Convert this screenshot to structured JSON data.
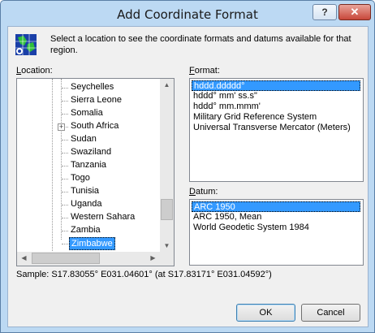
{
  "window": {
    "title": "Add Coordinate Format",
    "help_glyph": "?",
    "close_glyph": "✕"
  },
  "intro_text": "Select a location to see the coordinate formats and datums available for that region.",
  "location": {
    "label_prefix": "",
    "label_accel": "L",
    "label_rest": "ocation:",
    "items": [
      {
        "label": "Seychelles",
        "expandable": false
      },
      {
        "label": "Sierra Leone",
        "expandable": false
      },
      {
        "label": "Somalia",
        "expandable": false
      },
      {
        "label": "South Africa",
        "expandable": true
      },
      {
        "label": "Sudan",
        "expandable": false
      },
      {
        "label": "Swaziland",
        "expandable": false
      },
      {
        "label": "Tanzania",
        "expandable": false
      },
      {
        "label": "Togo",
        "expandable": false
      },
      {
        "label": "Tunisia",
        "expandable": false
      },
      {
        "label": "Uganda",
        "expandable": false
      },
      {
        "label": "Western Sahara",
        "expandable": false
      },
      {
        "label": "Zambia",
        "expandable": false
      },
      {
        "label": "Zimbabwe",
        "expandable": false,
        "selected": true
      }
    ],
    "scroll_position": 0.85
  },
  "format": {
    "label_accel": "F",
    "label_rest": "ormat:",
    "items": [
      {
        "label": "hddd.ddddd°",
        "selected": true
      },
      {
        "label": "hddd° mm' ss.s\"",
        "selected": false
      },
      {
        "label": "hddd° mm.mmm'",
        "selected": false
      },
      {
        "label": "Military Grid Reference System",
        "selected": false
      },
      {
        "label": "Universal Transverse Mercator (Meters)",
        "selected": false
      }
    ]
  },
  "datum": {
    "label_accel": "D",
    "label_rest": "atum:",
    "items": [
      {
        "label": "ARC 1950",
        "selected": true
      },
      {
        "label": "ARC 1950, Mean",
        "selected": false
      },
      {
        "label": "World Geodetic System 1984",
        "selected": false
      }
    ]
  },
  "sample_text": "Sample: S17.83055° E031.04601° (at S17.83171° E031.04592°)",
  "buttons": {
    "ok": "OK",
    "cancel": "Cancel"
  }
}
